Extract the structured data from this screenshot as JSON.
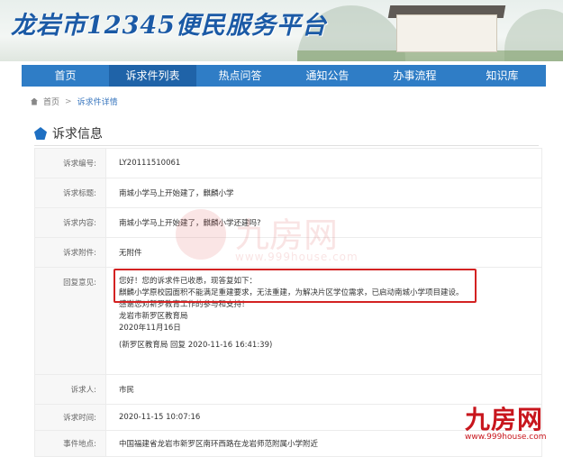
{
  "header": {
    "title": "龙岩市12345便民服务平台"
  },
  "nav": {
    "items": [
      "首页",
      "诉求件列表",
      "热点问答",
      "通知公告",
      "办事流程",
      "知识库"
    ],
    "active_index": 1
  },
  "breadcrumb": {
    "home": "首页",
    "separator": ">",
    "current": "诉求件详情"
  },
  "section": {
    "title": "诉求信息"
  },
  "fields": {
    "number": {
      "label": "诉求编号:",
      "value": "LY20111510061"
    },
    "subject": {
      "label": "诉求标题:",
      "value": "南城小学马上开始建了，麒麟小学"
    },
    "content": {
      "label": "诉求内容:",
      "value": "南城小学马上开始建了，麒麟小学还建吗?"
    },
    "attachment": {
      "label": "诉求附件:",
      "value": "无附件"
    },
    "reply": {
      "label": "回复意见:",
      "lines": [
        "您好！您的诉求件已收悉，现答复如下：",
        "麒麟小学原校园面积不能满足重建要求，无法重建，为解决片区学位需求，已启动南城小学项目建设。",
        "感谢您对新罗教育工作的参与和支持！",
        "龙岩市新罗区教育局",
        "2020年11月16日",
        "",
        "(新罗区教育局 回复 2020-11-16 16:41:39)"
      ]
    },
    "requester": {
      "label": "诉求人:",
      "value": "市民"
    },
    "time": {
      "label": "诉求时间:",
      "value": "2020-11-15 10:07:16"
    },
    "location": {
      "label": "事件地点:",
      "value": "中国福建省龙岩市新罗区南环西路在龙岩师范附属小学附近"
    }
  },
  "watermark": {
    "text": "九房网",
    "url": "www.999house.com"
  },
  "corner_logo": {
    "brand": "九房网",
    "url": "www.999house.com"
  },
  "colors": {
    "title_blue": "#1b5aa6",
    "nav_blue": "#2f7dc6",
    "nav_active": "#1f63a8",
    "highlight_red": "#d32222",
    "brand_red": "#c8161d"
  }
}
